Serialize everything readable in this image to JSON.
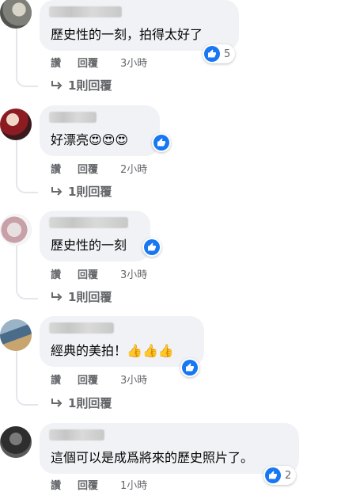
{
  "colors": {
    "bubble": "#f0f2f5",
    "like_blue": "#1877f2",
    "meta_gray": "#65676b"
  },
  "comments": [
    {
      "text": "歷史性的一刻，拍得太好了",
      "emoji": "",
      "reaction_icon": "like-icon",
      "reaction_count": "5",
      "actions": {
        "read": "讚",
        "reply": "回覆",
        "time": "3小時"
      },
      "replies": "1則回覆"
    },
    {
      "text": "好漂亮",
      "emoji": "😍😍😍",
      "reaction_icon": "like-icon",
      "reaction_count": "",
      "actions": {
        "read": "讚",
        "reply": "回覆",
        "time": "2小時"
      },
      "replies": "1則回覆"
    },
    {
      "text": "歷史性的一刻",
      "emoji": "",
      "reaction_icon": "like-icon",
      "reaction_count": "",
      "actions": {
        "read": "讚",
        "reply": "回覆",
        "time": "3小時"
      },
      "replies": "1則回覆"
    },
    {
      "text": "經典的美拍！",
      "emoji": "👍👍👍",
      "reaction_icon": "like-icon",
      "reaction_count": "",
      "actions": {
        "read": "讚",
        "reply": "回覆",
        "time": "3小時"
      },
      "replies": "1則回覆"
    },
    {
      "text": "這個可以是成爲將來的歷史照片了。",
      "emoji": "",
      "reaction_icon": "like-icon",
      "reaction_count": "2",
      "actions": {
        "read": "讚",
        "reply": "回覆",
        "time": "1小時"
      },
      "replies": ""
    }
  ]
}
